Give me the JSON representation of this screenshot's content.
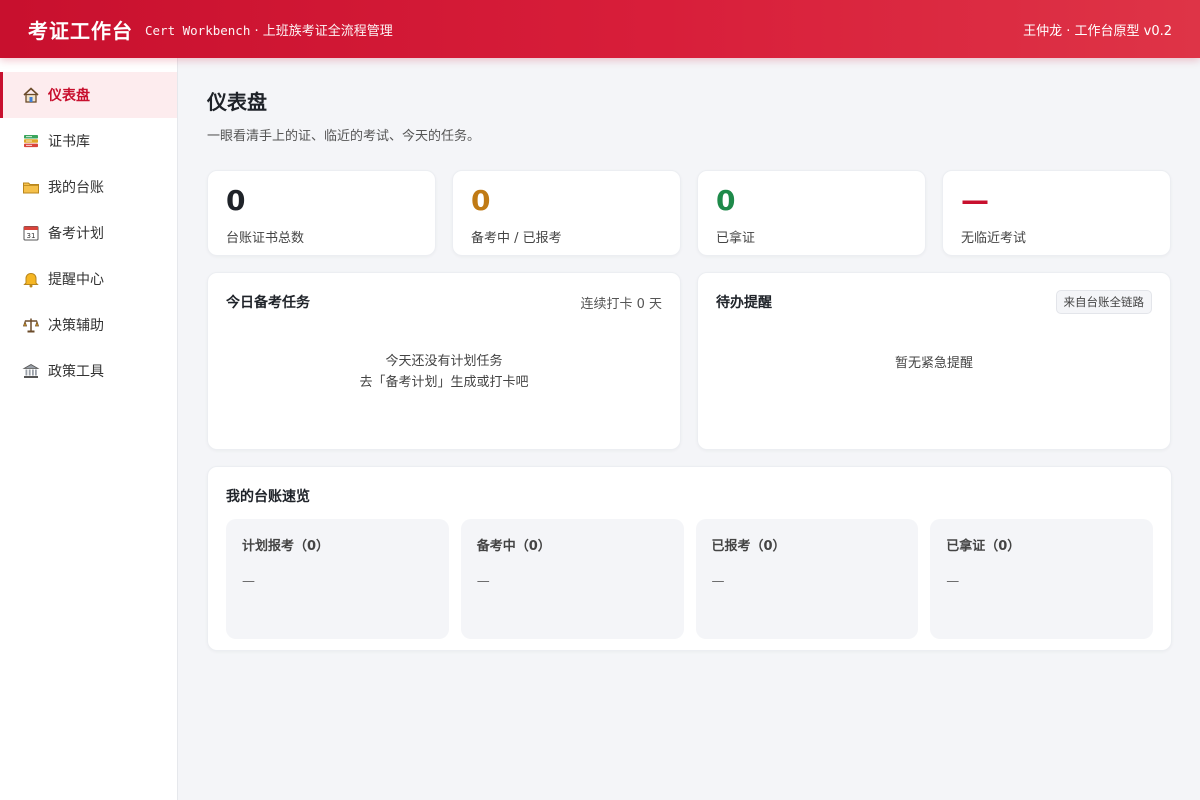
{
  "header": {
    "title": "考证工作台",
    "subtitle_en": "Cert Workbench",
    "subtitle_cn": " · 上班族考证全流程管理",
    "user": "王仲龙 · 工作台原型 v0.2"
  },
  "sidebar": {
    "items": [
      {
        "label": "仪表盘",
        "icon": "home-icon",
        "active": true
      },
      {
        "label": "证书库",
        "icon": "books-icon"
      },
      {
        "label": "我的台账",
        "icon": "folder-icon"
      },
      {
        "label": "备考计划",
        "icon": "calendar-icon"
      },
      {
        "label": "提醒中心",
        "icon": "bell-icon"
      },
      {
        "label": "决策辅助",
        "icon": "scales-icon"
      },
      {
        "label": "政策工具",
        "icon": "bank-icon"
      }
    ]
  },
  "page": {
    "title": "仪表盘",
    "desc": "一眼看清手上的证、临近的考试、今天的任务。"
  },
  "stats": [
    {
      "value": "0",
      "label": "台账证书总数",
      "color": "#1f2329"
    },
    {
      "value": "0",
      "label": "备考中 / 已报考",
      "color": "#c07a14"
    },
    {
      "value": "0",
      "label": "已拿证",
      "color": "#1e8a4a"
    },
    {
      "value": "—",
      "label": "无临近考试",
      "color": "#c8102e"
    }
  ],
  "today_tasks": {
    "title": "今日备考任务",
    "streak": "连续打卡 0 天",
    "empty_line1": "今天还没有计划任务",
    "empty_line2": "去「备考计划」生成或打卡吧"
  },
  "reminders": {
    "title": "待办提醒",
    "chip": "来自台账全链路",
    "empty": "暂无紧急提醒"
  },
  "ledger_overview": {
    "title": "我的台账速览",
    "columns": [
      {
        "title": "计划报考（0）",
        "empty": "—"
      },
      {
        "title": "备考中（0）",
        "empty": "—"
      },
      {
        "title": "已报考（0）",
        "empty": "—"
      },
      {
        "title": "已拿证（0）",
        "empty": "—"
      }
    ]
  },
  "colors": {
    "brand": "#c8102e",
    "active_bg": "#fdecee"
  }
}
